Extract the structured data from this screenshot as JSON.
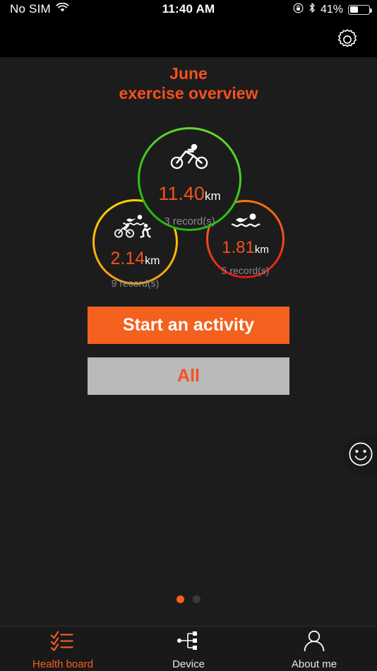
{
  "status_bar": {
    "carrier": "No SIM",
    "wifi_icon": "wifi-icon",
    "time": "11:40 AM",
    "rotation_lock_icon": "rotation-lock-icon",
    "bluetooth_icon": "bluetooth-icon",
    "battery_percent": "41%",
    "battery_level": 41
  },
  "nav_bar": {
    "settings_icon": "gear-icon"
  },
  "header": {
    "month": "June",
    "subtitle": "exercise overview"
  },
  "summary": {
    "cycling": {
      "icon": "cycling-icon",
      "distance": "11.40",
      "unit": "km",
      "records": "3 record(s)",
      "ring_color": "#3fc820"
    },
    "triathlon": {
      "icon": "triathlon-icon",
      "distance": "2.14",
      "unit": "km",
      "records": "9 record(s)",
      "ring_color": "#ffc000"
    },
    "swimming": {
      "icon": "swimming-icon",
      "distance": "1.81",
      "unit": "km",
      "records": "5 record(s)",
      "ring_color": "#f4511e"
    }
  },
  "actions": {
    "start_label": "Start an activity",
    "all_label": "All"
  },
  "feedback": {
    "icon": "smiley-face-icon"
  },
  "pagination": {
    "current": 1,
    "total": 2
  },
  "tab_bar": {
    "items": [
      {
        "label": "Health board",
        "icon": "checklist-icon",
        "active": true
      },
      {
        "label": "Device",
        "icon": "device-node-icon",
        "active": false
      },
      {
        "label": "About me",
        "icon": "person-icon",
        "active": false
      }
    ]
  },
  "theme": {
    "accent": "#f4601e",
    "background": "#1c1c1c",
    "bar_background": "#000000"
  }
}
